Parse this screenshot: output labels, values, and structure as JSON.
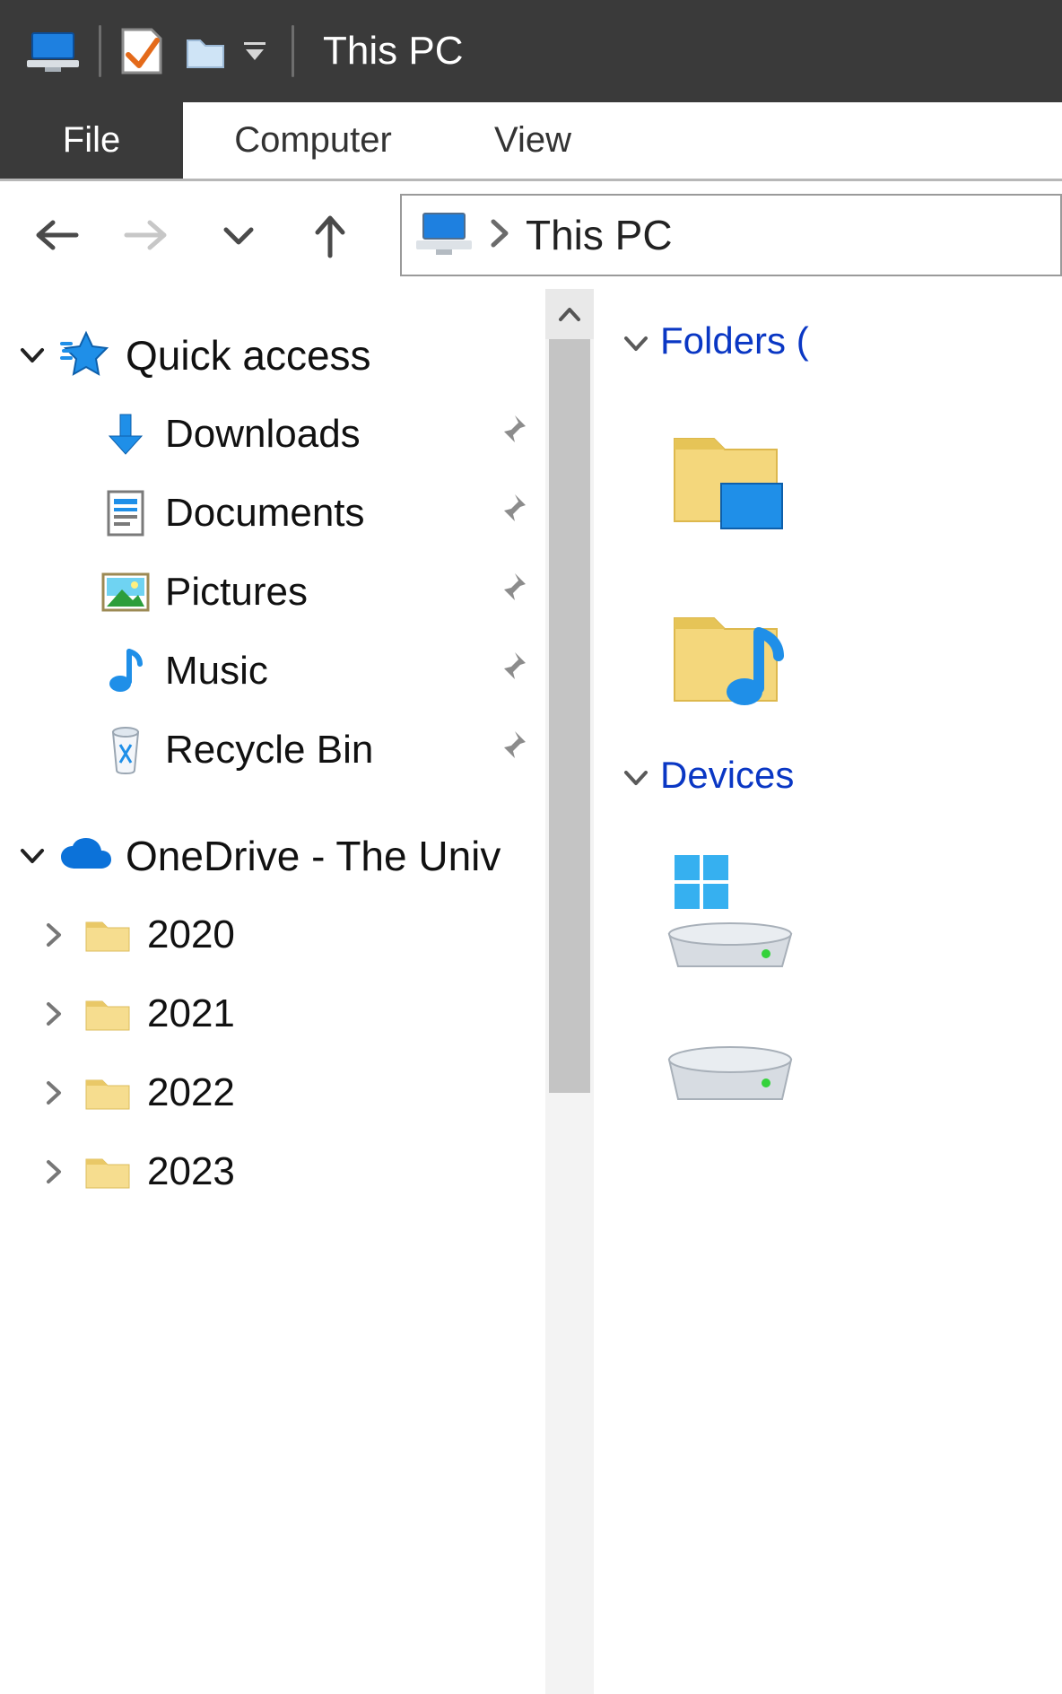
{
  "titlebar": {
    "title": "This PC"
  },
  "ribbon": {
    "file": "File",
    "computer": "Computer",
    "view": "View"
  },
  "address": {
    "location": "This PC"
  },
  "tree": {
    "quick_access": "Quick access",
    "quick_items": [
      {
        "label": "Downloads"
      },
      {
        "label": "Documents"
      },
      {
        "label": "Pictures"
      },
      {
        "label": "Music"
      },
      {
        "label": "Recycle Bin"
      }
    ],
    "onedrive": "OneDrive - The Univ",
    "onedrive_items": [
      {
        "label": "2020"
      },
      {
        "label": "2021"
      },
      {
        "label": "2022"
      },
      {
        "label": "2023"
      }
    ]
  },
  "content": {
    "group_folders": "Folders (",
    "group_devices": "Devices "
  }
}
